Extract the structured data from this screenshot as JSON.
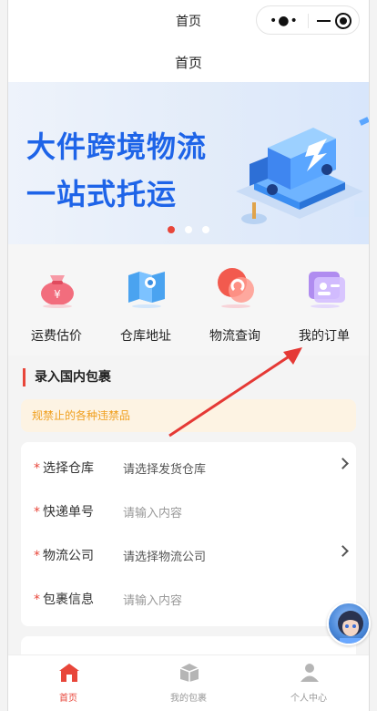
{
  "window": {
    "title": "首页"
  },
  "capsule": {
    "more_icon": "more-dots-icon",
    "minimize_icon": "minimize-icon",
    "close_icon": "target-close-icon"
  },
  "navbar": {
    "title": "首页"
  },
  "banner": {
    "line1": "大件跨境物流",
    "line2": "一站式托运",
    "slides": 3,
    "active_slide": 1
  },
  "menu": [
    {
      "label": "运费估价",
      "icon": "money-bag-icon"
    },
    {
      "label": "仓库地址",
      "icon": "map-icon"
    },
    {
      "label": "物流查询",
      "icon": "search-logistics-icon"
    },
    {
      "label": "我的订单",
      "icon": "order-card-icon"
    }
  ],
  "section": {
    "title": "录入国内包裹"
  },
  "notice": {
    "text": "规禁止的各种违禁品"
  },
  "form": {
    "rows": [
      {
        "label": "选择仓库",
        "value": "请选择发货仓库",
        "has_arrow": true
      },
      {
        "label": "快递单号",
        "value": "请输入内容",
        "has_arrow": false
      },
      {
        "label": "物流公司",
        "value": "请选择物流公司",
        "has_arrow": true
      },
      {
        "label": "包裹信息",
        "value": "请输入内容",
        "has_arrow": false
      }
    ],
    "required_mark": "*"
  },
  "tabbar": [
    {
      "label": "首页",
      "icon": "home-icon",
      "active": true
    },
    {
      "label": "我的包裹",
      "icon": "package-icon",
      "active": false
    },
    {
      "label": "个人中心",
      "icon": "user-icon",
      "active": false
    }
  ],
  "colors": {
    "accent": "#e8463a",
    "brand_blue": "#1e64e8",
    "notice_text": "#f0a020",
    "arrow": "#e53935"
  }
}
